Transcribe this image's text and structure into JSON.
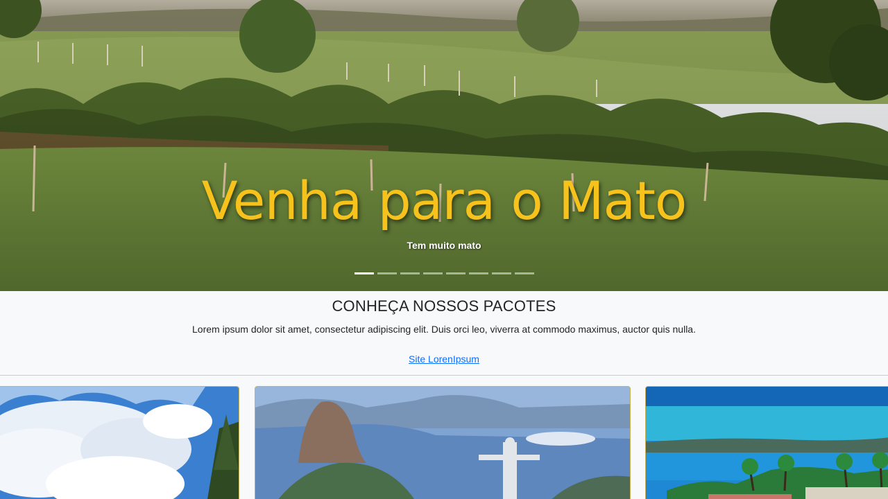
{
  "hero": {
    "title": "Venha para o Mato",
    "subtitle": "Tem muito mato",
    "slide_count": 8,
    "active_slide": 0
  },
  "intro": {
    "title": "CONHEÇA NOSSOS PACOTES",
    "text": "Lorem ipsum dolor sit amet, consectetur adipiscing elit. Duis orci leo, viverra at commodo maximus, auctor quis nulla.",
    "link_label": "Site LorenIpsum"
  },
  "colors": {
    "hero_title": "#f7c21b",
    "link": "#0d6efd",
    "card_border": "#c9b25a"
  }
}
